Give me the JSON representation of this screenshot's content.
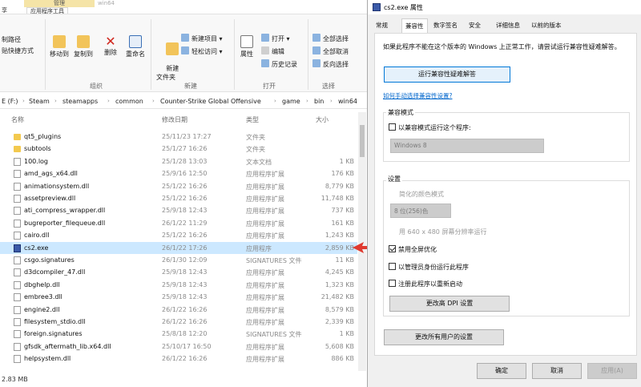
{
  "explorer": {
    "context_header": "管理",
    "tabs": [
      "享",
      "应用程序工具"
    ],
    "dim_title": "win64",
    "ribbon": {
      "left_items": [
        "制路径",
        "贴快捷方式"
      ],
      "organize": {
        "move_to": "移动到",
        "copy_to": "复制到",
        "delete": "删除",
        "rename": "重命名",
        "label": "组织"
      },
      "new": {
        "new_folder": "新建\n文件夹",
        "new_item": "新建项目 ▾",
        "easy_access": "轻松访问 ▾",
        "label": "新建"
      },
      "open": {
        "properties": "属性",
        "open": "打开 ▾",
        "edit": "编辑",
        "history": "历史记录",
        "label": "打开"
      },
      "select": {
        "select_all": "全部选择",
        "select_none": "全部取消",
        "invert": "反向选择",
        "label": "选择"
      }
    },
    "address": [
      "E (F:)",
      "Steam",
      "steamapps",
      "common",
      "Counter-Strike Global Offensive",
      "game",
      "bin",
      "win64"
    ],
    "columns": {
      "name": "名称",
      "date": "修改日期",
      "type": "类型",
      "size": "大小"
    },
    "files": [
      {
        "name": "qt5_plugins",
        "date": "25/11/23 17:27",
        "type": "文件夹",
        "size": "",
        "icon": "folder"
      },
      {
        "name": "subtools",
        "date": "25/1/27 16:26",
        "type": "文件夹",
        "size": "",
        "icon": "folder"
      },
      {
        "name": "100.log",
        "date": "25/1/28 13:03",
        "type": "文本文档",
        "size": "1 KB",
        "icon": "file"
      },
      {
        "name": "amd_ags_x64.dll",
        "date": "25/9/16 12:50",
        "type": "应用程序扩展",
        "size": "176 KB",
        "icon": "file"
      },
      {
        "name": "animationsystem.dll",
        "date": "25/1/22 16:26",
        "type": "应用程序扩展",
        "size": "8,779 KB",
        "icon": "file"
      },
      {
        "name": "assetpreview.dll",
        "date": "25/1/22 16:26",
        "type": "应用程序扩展",
        "size": "11,748 KB",
        "icon": "file"
      },
      {
        "name": "ati_compress_wrapper.dll",
        "date": "25/9/18 12:43",
        "type": "应用程序扩展",
        "size": "737 KB",
        "icon": "file"
      },
      {
        "name": "bugreporter_filequeue.dll",
        "date": "26/1/22 11:29",
        "type": "应用程序扩展",
        "size": "161 KB",
        "icon": "file"
      },
      {
        "name": "cairo.dll",
        "date": "25/1/22 16:26",
        "type": "应用程序扩展",
        "size": "1,243 KB",
        "icon": "file"
      },
      {
        "name": "cs2.exe",
        "date": "26/1/22 17:26",
        "type": "应用程序",
        "size": "2,859 KB",
        "icon": "exe",
        "selected": true
      },
      {
        "name": "csgo.signatures",
        "date": "26/1/30 12:09",
        "type": "SIGNATURES 文件",
        "size": "11 KB",
        "icon": "file"
      },
      {
        "name": "d3dcompiler_47.dll",
        "date": "25/9/18 12:43",
        "type": "应用程序扩展",
        "size": "4,245 KB",
        "icon": "file"
      },
      {
        "name": "dbghelp.dll",
        "date": "25/9/18 12:43",
        "type": "应用程序扩展",
        "size": "1,323 KB",
        "icon": "file"
      },
      {
        "name": "embree3.dll",
        "date": "25/9/18 12:43",
        "type": "应用程序扩展",
        "size": "21,482 KB",
        "icon": "file"
      },
      {
        "name": "engine2.dll",
        "date": "26/1/22 16:26",
        "type": "应用程序扩展",
        "size": "8,579 KB",
        "icon": "file"
      },
      {
        "name": "filesystem_stdio.dll",
        "date": "26/1/22 16:26",
        "type": "应用程序扩展",
        "size": "2,339 KB",
        "icon": "file"
      },
      {
        "name": "foreign.signatures",
        "date": "25/8/18 12:20",
        "type": "SIGNATURES 文件",
        "size": "1 KB",
        "icon": "file"
      },
      {
        "name": "gfsdk_aftermath_lib.x64.dll",
        "date": "25/10/17 16:50",
        "type": "应用程序扩展",
        "size": "5,608 KB",
        "icon": "file"
      },
      {
        "name": "helpsystem.dll",
        "date": "26/1/22 16:26",
        "type": "应用程序扩展",
        "size": "886 KB",
        "icon": "file"
      }
    ],
    "status": "2.83 MB"
  },
  "dialog": {
    "title": "cs2.exe 属性",
    "tabs": [
      "常规",
      "兼容性",
      "数字签名",
      "安全",
      "详细信息",
      "以前的版本"
    ],
    "active_tab": 1,
    "intro": "如果此程序不能在这个版本的 Windows 上正常工作，请尝试运行兼容性疑难解答。",
    "run_troubleshooter": "运行兼容性疑难解答",
    "manual_link": "如何手动选择兼容性设置?",
    "compat_mode": {
      "label": "兼容模式",
      "checkbox": "以兼容模式运行这个程序:",
      "select_value": "Windows 8"
    },
    "settings": {
      "label": "设置",
      "reduced_color": "简化的颜色模式",
      "color_value": "8 位(256)色",
      "resolution": "用 640 x 480 屏幕分辨率运行",
      "fullscreen_opt": "禁用全屏优化",
      "run_admin": "以管理员身份运行此程序",
      "register_restart": "注册此程序以重新启动",
      "dpi_button": "更改高 DPI 设置"
    },
    "all_users_button": "更改所有用户的设置",
    "ok": "确定",
    "cancel": "取消",
    "apply": "应用(A)"
  }
}
